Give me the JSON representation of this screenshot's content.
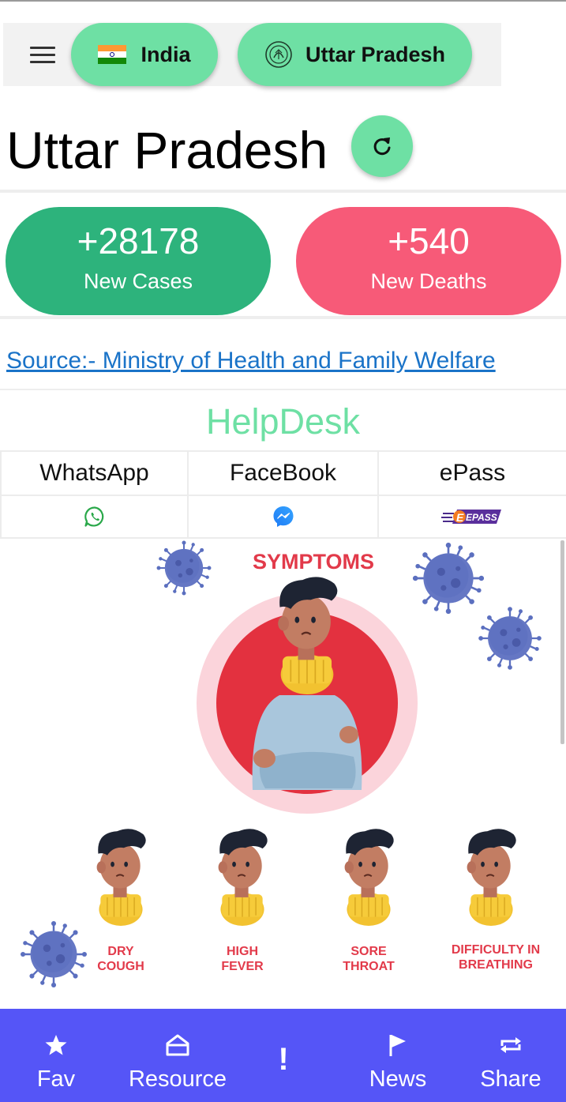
{
  "selector": {
    "country": "India",
    "state": "Uttar Pradesh"
  },
  "page": {
    "title": "Uttar Pradesh"
  },
  "stats": {
    "cases_value": "+28178",
    "cases_label": "New Cases",
    "deaths_value": "+540",
    "deaths_label": "New Deaths"
  },
  "source": {
    "text": "Source:- Ministry of Health and Family Welfare "
  },
  "helpdesk": {
    "title": "HelpDesk",
    "columns": [
      "WhatsApp",
      "FaceBook",
      "ePass"
    ],
    "epass_badge": "EPASS"
  },
  "poster": {
    "heading": "SYMPTOMS",
    "symptoms": [
      {
        "line1": "DRY",
        "line2": "COUGH"
      },
      {
        "line1": "HIGH",
        "line2": "FEVER"
      },
      {
        "line1": "SORE",
        "line2": "THROAT"
      },
      {
        "line1": "DIFFICULTY IN",
        "line2": "BREATHING"
      }
    ]
  },
  "nav": {
    "items": [
      "Fav",
      "Resource",
      "",
      "News",
      "Share"
    ],
    "alert_glyph": "!"
  },
  "colors": {
    "accent_green": "#6ee0a4",
    "cases_green": "#2db37c",
    "deaths_red": "#f75a78",
    "nav_blue": "#5555f7",
    "link_blue": "#1a73c8",
    "virus_blue": "#5b6fbf",
    "poster_red": "#e23a4a"
  },
  "icons": {
    "menu": "hamburger-icon",
    "india": "india-flag-icon",
    "up": "up-emblem-icon",
    "refresh": "refresh-icon",
    "whatsapp": "whatsapp-icon",
    "facebook": "messenger-icon",
    "epass": "epass-icon",
    "fav": "star-icon",
    "resource": "home-icon",
    "alert": "exclamation-icon",
    "news": "flag-icon",
    "share": "repeat-icon"
  }
}
